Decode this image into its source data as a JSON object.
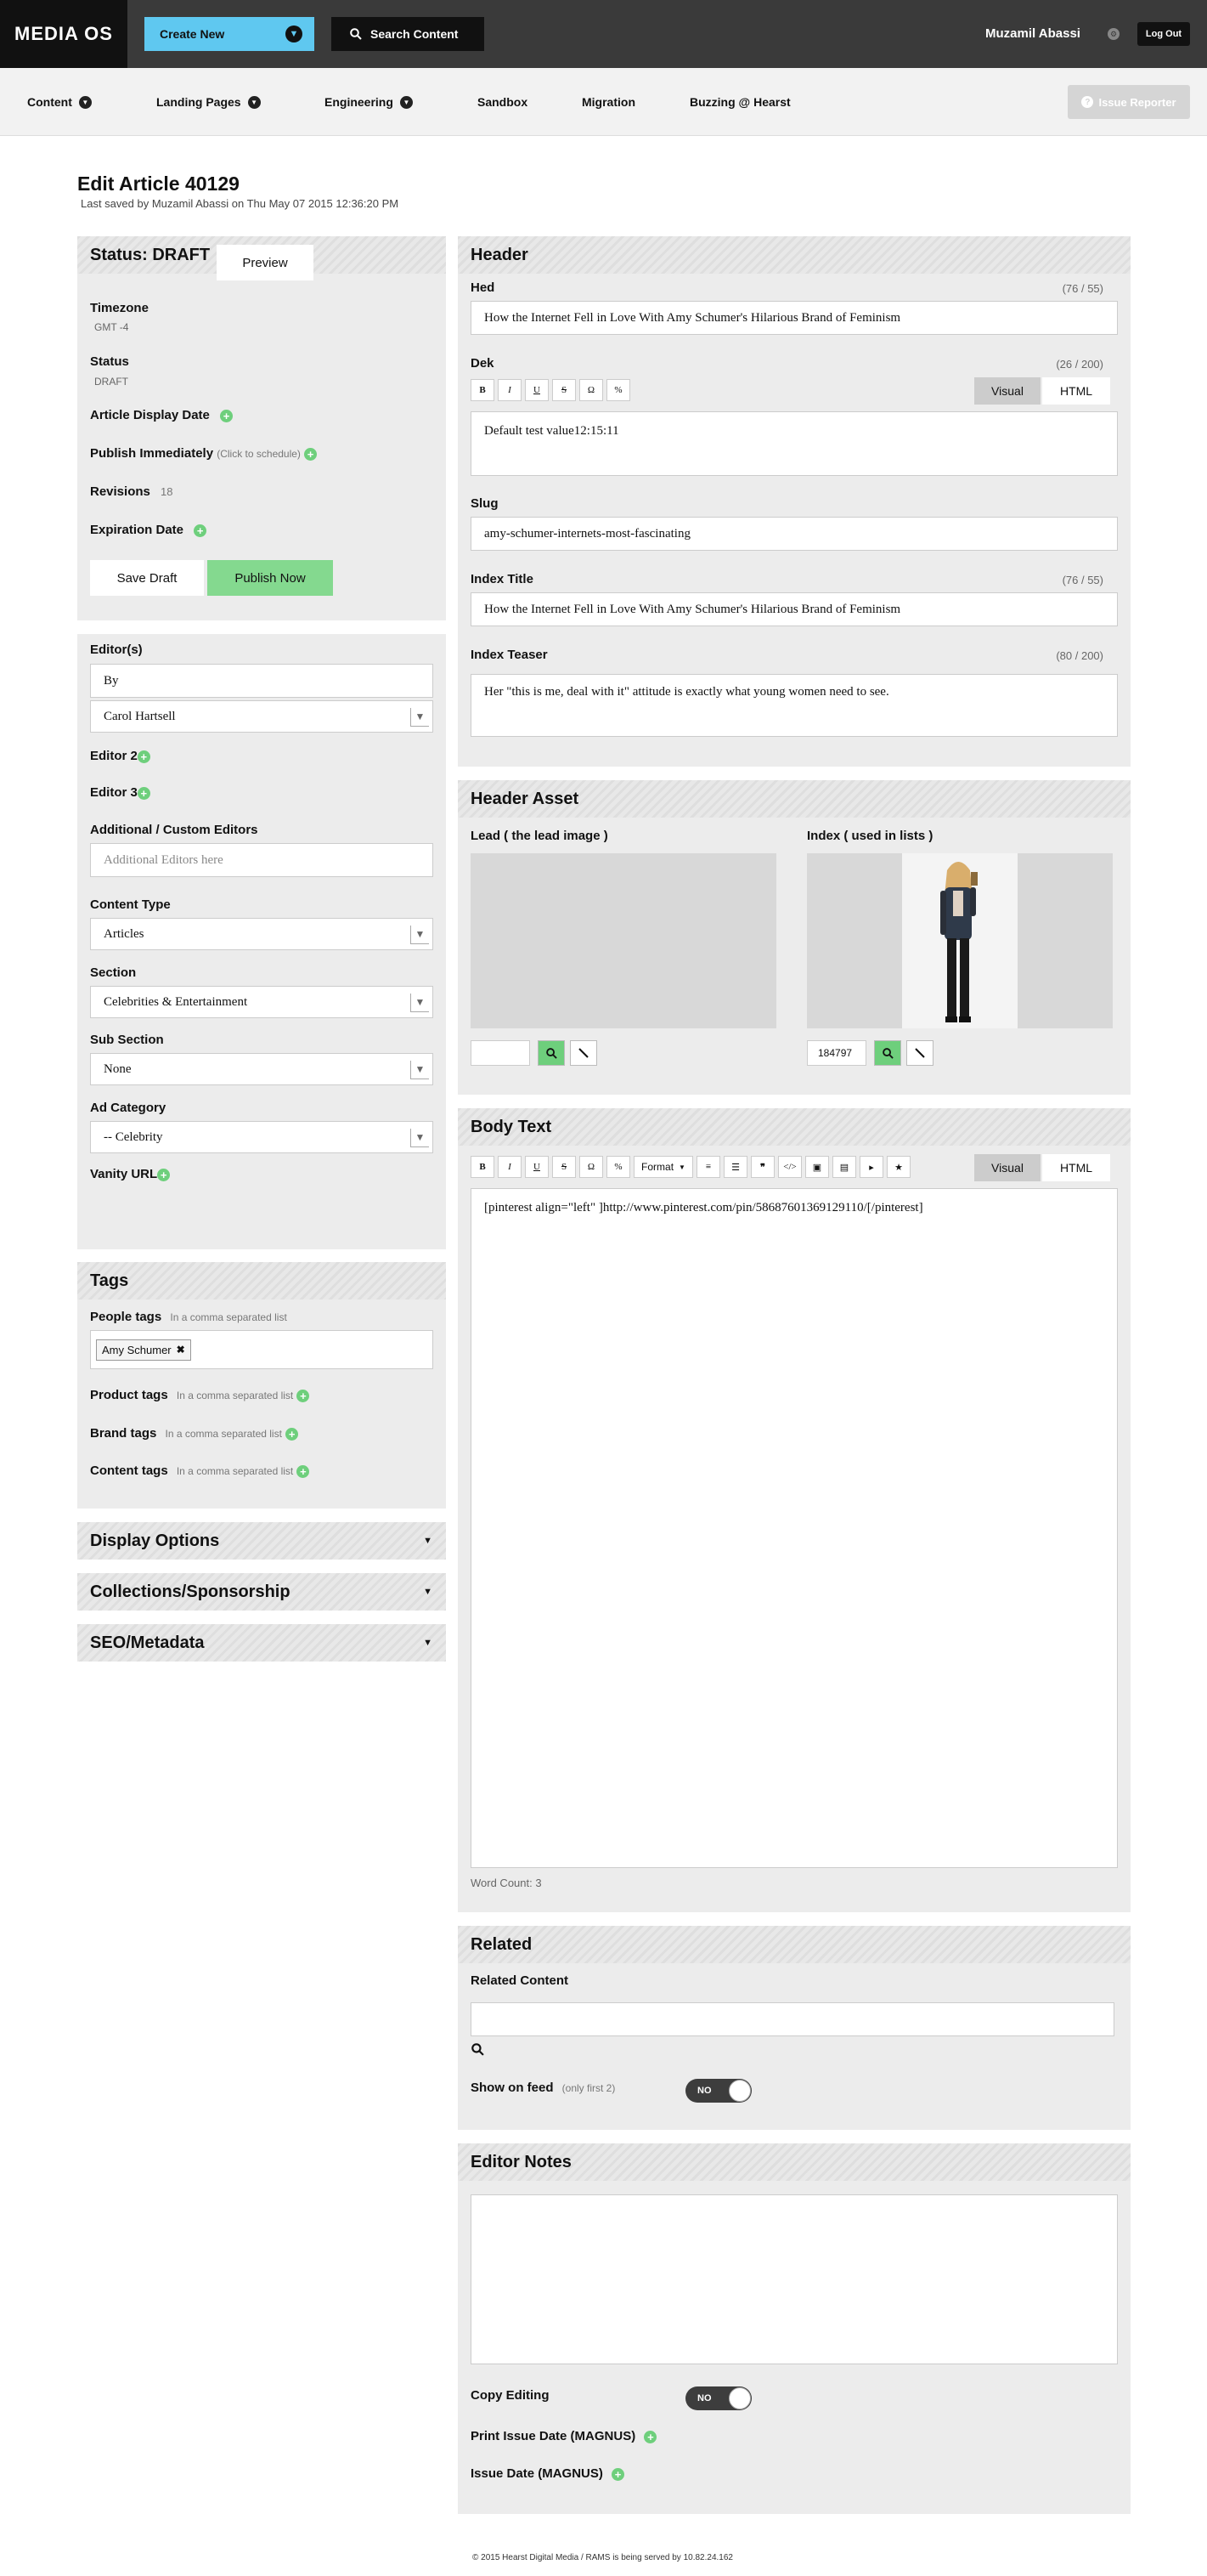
{
  "app": {
    "logo": "MEDIA OS",
    "create_new": "Create New",
    "search_content": "Search Content",
    "user": "Muzamil Abassi",
    "logout": "Log Out"
  },
  "nav": {
    "items": [
      "Content",
      "Landing Pages",
      "Engineering",
      "Sandbox",
      "Migration",
      "Buzzing @ Hearst"
    ],
    "issue_reporter": "Issue Reporter"
  },
  "page": {
    "title": "Edit Article 40129",
    "last_saved": "Last saved by Muzamil Abassi on Thu May 07 2015 12:36:20 PM"
  },
  "status_panel": {
    "status": "Status: DRAFT",
    "preview": "Preview",
    "timezone_label": "Timezone",
    "timezone_value": "GMT -4",
    "status_label": "Status",
    "status_value": "DRAFT",
    "display_date_label": "Article Display Date",
    "publish_immediately_label": "Publish Immediately",
    "publish_note": "(Click to schedule)",
    "revisions_label": "Revisions",
    "revisions_value": "18",
    "expiration_label": "Expiration Date",
    "save_draft": "Save Draft",
    "publish_now": "Publish Now"
  },
  "editors_panel": {
    "editors_label": "Editor(s)",
    "by_value": "By",
    "editor_select": "Carol Hartsell",
    "editor2": "Editor 2",
    "editor3": "Editor 3",
    "custom_label": "Additional / Custom Editors",
    "custom_placeholder": "Additional Editors here",
    "content_type_label": "Content Type",
    "content_type": "Articles",
    "section_label": "Section",
    "section": "Celebrities & Entertainment",
    "subsection_label": "Sub Section",
    "subsection": "None",
    "ad_label": "Ad Category",
    "ad": "-- Celebrity",
    "vanity_label": "Vanity URL"
  },
  "tags": {
    "title": "Tags",
    "people_label": "People tags",
    "people_note": "In a comma separated list",
    "people_tag": "Amy Schumer",
    "product_label": "Product tags",
    "product_note": "In a comma separated list",
    "brand_label": "Brand tags",
    "brand_note": "In a comma separated list",
    "content_label": "Content tags",
    "content_note": "In a comma separated list"
  },
  "folds": [
    "Display Options",
    "Collections/Sponsorship",
    "SEO/Metadata"
  ],
  "header": {
    "title": "Header",
    "hed_label": "Hed",
    "hed_count": "(76 / 55)",
    "hed_value": "How the Internet Fell in Love With Amy Schumer's Hilarious Brand of Feminism",
    "dek_label": "Dek",
    "dek_count": "(26 / 200)",
    "dek_value": "Default test value12:15:11",
    "visual": "Visual",
    "html": "HTML",
    "slug_label": "Slug",
    "slug_value": "amy-schumer-internets-most-fascinating",
    "index_title_label": "Index Title",
    "index_title_count": "(76 / 55)",
    "index_title_value": "How the Internet Fell in Love With Amy Schumer's Hilarious Brand of Feminism",
    "teaser_label": "Index Teaser",
    "teaser_count": "(80 / 200)",
    "teaser_value": "Her \"this is me, deal with it\" attitude is exactly what young women need to see."
  },
  "header_asset": {
    "title": "Header Asset",
    "lead_label": "Lead ( the lead image )",
    "index_label": "Index ( used in lists )",
    "index_id": "184797"
  },
  "body": {
    "title": "Body Text",
    "format": "Format",
    "visual": "Visual",
    "html": "HTML",
    "content": "[pinterest align=\"left\" ]http://www.pinterest.com/pin/58687601369129110/[/pinterest]",
    "word_count": "Word Count: 3"
  },
  "related": {
    "title": "Related",
    "content_label": "Related Content",
    "show_feed_label": "Show on feed",
    "show_feed_note": "(only first 2)",
    "toggle": "NO"
  },
  "notes": {
    "title": "Editor Notes",
    "copy_label": "Copy Editing",
    "toggle": "NO",
    "print_label": "Print Issue Date (MAGNUS)",
    "issue_label": "Issue Date (MAGNUS)"
  },
  "footer": "© 2015 Hearst Digital Media / RAMS is being served by 10.82.24.162"
}
